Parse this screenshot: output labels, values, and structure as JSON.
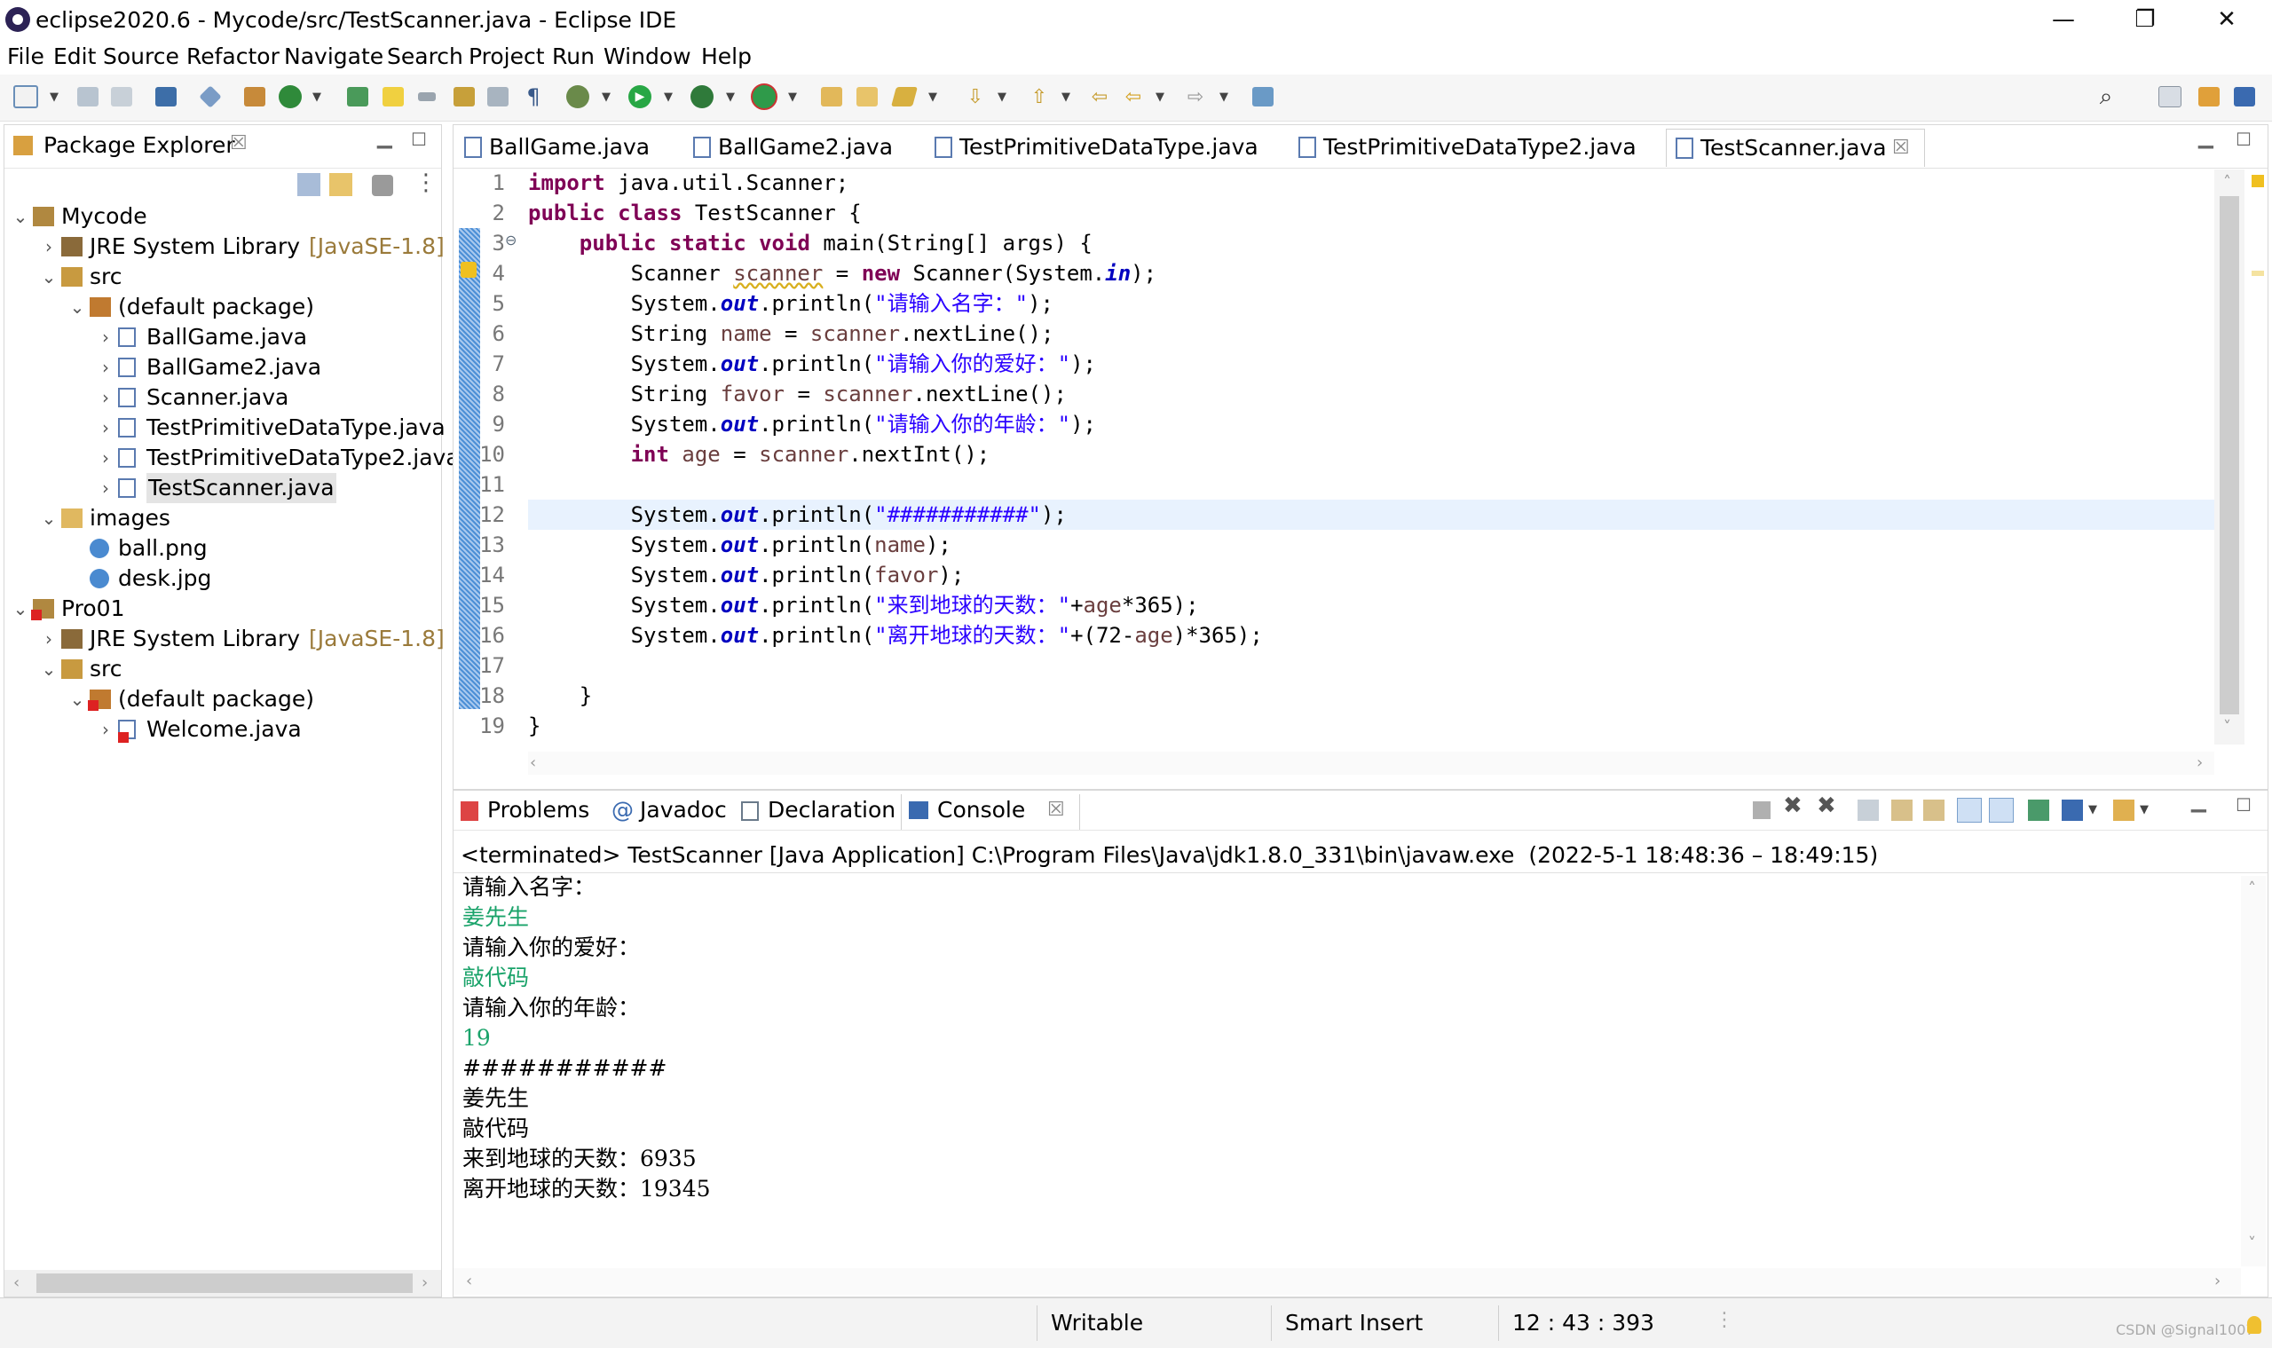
{
  "window": {
    "title": "eclipse2020.6 - Mycode/src/TestScanner.java - Eclipse IDE",
    "minimize": "—",
    "maximize": "❐",
    "close": "✕"
  },
  "menu": [
    "File",
    "Edit",
    "Source",
    "Refactor",
    "Navigate",
    "Search",
    "Project",
    "Run",
    "Window",
    "Help"
  ],
  "package_explorer": {
    "title": "Package Explorer",
    "tree": [
      {
        "label": "Mycode",
        "decoration": "",
        "icon": "project-icon",
        "expanded": true
      },
      {
        "label": "JRE System Library",
        "decoration": "[JavaSE-1.8]",
        "icon": "library-icon"
      },
      {
        "label": "src",
        "decoration": "",
        "icon": "source-folder-icon"
      },
      {
        "label": "(default package)",
        "decoration": "",
        "icon": "package-icon"
      },
      {
        "label": "BallGame.java",
        "decoration": "",
        "icon": "java-file-icon"
      },
      {
        "label": "BallGame2.java",
        "decoration": "",
        "icon": "java-file-icon"
      },
      {
        "label": "Scanner.java",
        "decoration": "",
        "icon": "java-file-icon"
      },
      {
        "label": "TestPrimitiveDataType.java",
        "decoration": "",
        "icon": "java-file-icon"
      },
      {
        "label": "TestPrimitiveDataType2.java",
        "decoration": "",
        "icon": "java-file-icon"
      },
      {
        "label": "TestScanner.java",
        "decoration": "",
        "icon": "java-file-icon",
        "selected": true
      },
      {
        "label": "images",
        "decoration": "",
        "icon": "folder-icon"
      },
      {
        "label": "ball.png",
        "decoration": "",
        "icon": "image-file-icon"
      },
      {
        "label": "desk.jpg",
        "decoration": "",
        "icon": "image-file-icon"
      },
      {
        "label": "Pro01",
        "decoration": "",
        "icon": "project-error-icon"
      },
      {
        "label": "JRE System Library",
        "decoration": "[JavaSE-1.8]",
        "icon": "library-icon"
      },
      {
        "label": "src",
        "decoration": "",
        "icon": "source-folder-icon"
      },
      {
        "label": "(default package)",
        "decoration": "",
        "icon": "package-error-icon"
      },
      {
        "label": "Welcome.java",
        "decoration": "",
        "icon": "java-file-error-icon"
      }
    ]
  },
  "editor": {
    "tabs": [
      "BallGame.java",
      "BallGame2.java",
      "TestPrimitiveDataType.java",
      "TestPrimitiveDataType2.java",
      "TestScanner.java"
    ],
    "active_tab": "TestScanner.java",
    "line_numbers": [
      "1",
      "2",
      "3",
      "4",
      "5",
      "6",
      "7",
      "8",
      "9",
      "10",
      "11",
      "12",
      "13",
      "14",
      "15",
      "16",
      "17",
      "18",
      "19"
    ],
    "highlighted_line": "12"
  },
  "console": {
    "tabs": [
      "Problems",
      "Javadoc",
      "Declaration",
      "Console"
    ],
    "active_tab": "Console",
    "header": "<terminated> TestScanner [Java Application] C:\\Program Files\\Java\\jdk1.8.0_331\\bin\\javaw.exe  (2022-5-1 18:48:36 – 18:49:15)",
    "lines": [
      {
        "text": "请输入名字：",
        "input": false
      },
      {
        "text": "姜先生",
        "input": true
      },
      {
        "text": "请输入你的爱好：",
        "input": false
      },
      {
        "text": "敲代码",
        "input": true
      },
      {
        "text": "请输入你的年龄：",
        "input": false
      },
      {
        "text": "19",
        "input": true
      },
      {
        "text": "###########",
        "input": false
      },
      {
        "text": "姜先生",
        "input": false
      },
      {
        "text": "敲代码",
        "input": false
      },
      {
        "text": "来到地球的天数：6935",
        "input": false
      },
      {
        "text": "离开地球的天数：19345",
        "input": false
      }
    ]
  },
  "status": {
    "mode": "Writable",
    "insert": "Smart Insert",
    "position": "12 : 43 : 393",
    "watermark": "CSDN @Signal1007"
  },
  "colors": {
    "keyword": "#7f0055",
    "string": "#2a00ff",
    "static_field": "#0000c0",
    "local_var": "#6a3e3e",
    "console_input": "#1aa36a",
    "current_line": "#e8f2fe"
  }
}
